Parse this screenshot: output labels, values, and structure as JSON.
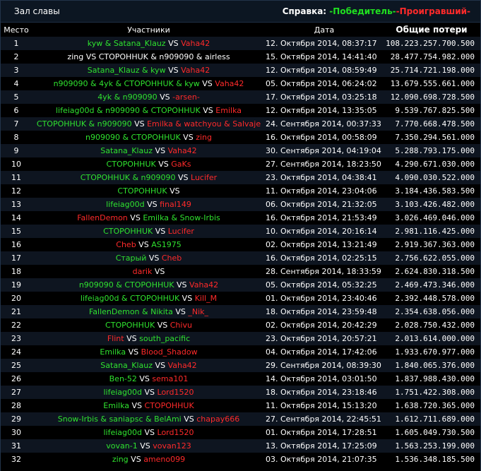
{
  "header": {
    "title": "Зал славы",
    "help_label": "Справка:",
    "legend_winner": "-Победитель-",
    "legend_loser": "-Проигравший-"
  },
  "columns": {
    "place": "Место",
    "participants": "Участники",
    "date": "Дата",
    "loss": "Общие потери"
  },
  "colors": {
    "winner": "#2fe22f",
    "loser": "#ff2a2a",
    "neutral": "#ffffff"
  },
  "rows": [
    {
      "n": "1",
      "w": "kyw & Satana_Klauz",
      "l": "Vaha42",
      "date": "12. Октября 2014, 08:37:17",
      "loss": "108.223.257.700.500"
    },
    {
      "n": "2",
      "w": "zing VS СТОРОННUK & n909090 & airless",
      "l": "",
      "neutral": true,
      "date": "15. Октября 2014, 14:41:40",
      "loss": "28.477.754.982.000"
    },
    {
      "n": "3",
      "w": "Satana_Klauz & kyw",
      "l": "Vaha42",
      "date": "12. Октября 2014, 08:59:49",
      "loss": "25.714.721.198.000"
    },
    {
      "n": "4",
      "w": "n909090 & 4yk & СТОРОННUK & kyw",
      "l": "Vaha42",
      "date": "05. Октября 2014, 06:24:02",
      "loss": "13.679.555.661.000"
    },
    {
      "n": "5",
      "w": "4yk & n909090",
      "l": "-arsen-",
      "date": "17. Октября 2014, 03:25:18",
      "loss": "12.090.698.728.500"
    },
    {
      "n": "6",
      "w": "lifeiag00d & n909090 & СТОРОННUK",
      "l": "Emilka",
      "date": "12. Октября 2014, 13:35:05",
      "loss": "9.539.767.825.500"
    },
    {
      "n": "7",
      "w": "СТОРОННUK & n909090",
      "l": "Emilka & watchyou & Salvaje",
      "date": "24. Сентября 2014, 00:37:33",
      "loss": "7.770.668.478.500"
    },
    {
      "n": "8",
      "w": "n909090 & СТОРОННUK",
      "l": "zing",
      "date": "16. Октября 2014, 00:58:09",
      "loss": "7.350.294.561.000"
    },
    {
      "n": "9",
      "w": "Satana_Klauz",
      "l": "Vaha42",
      "date": "30. Сентября 2014, 04:19:04",
      "loss": "5.288.793.175.000"
    },
    {
      "n": "10",
      "w": "СТОРОННUK",
      "l": "GaKs",
      "date": "27. Сентября 2014, 18:23:50",
      "loss": "4.290.671.030.000"
    },
    {
      "n": "11",
      "w": "СТОРОННUK & n909090",
      "l": "Lucifer",
      "date": "23. Октября 2014, 04:38:41",
      "loss": "4.090.030.522.000"
    },
    {
      "n": "12",
      "w": "СТОРОННUK",
      "l": "",
      "date": "11. Октября 2014, 23:04:06",
      "loss": "3.184.436.583.500"
    },
    {
      "n": "13",
      "w": "lifeiag00d",
      "l": "final149",
      "date": "06. Октября 2014, 21:32:05",
      "loss": "3.103.426.482.000"
    },
    {
      "n": "14",
      "w": "FallenDemon",
      "l": "Emilka & Snow-Irbis",
      "date": "16. Октября 2014, 21:53:49",
      "loss": "3.026.469.046.000",
      "swap": true
    },
    {
      "n": "15",
      "w": "СТОРОННUK",
      "l": "Lucifer",
      "date": "10. Октября 2014, 20:16:14",
      "loss": "2.981.116.425.000"
    },
    {
      "n": "16",
      "w": "Cheb",
      "l": "AS1975",
      "date": "02. Октября 2014, 13:21:49",
      "loss": "2.919.367.363.000",
      "swap": true
    },
    {
      "n": "17",
      "w": "Старый",
      "l": "Cheb",
      "date": "16. Октября 2014, 02:25:15",
      "loss": "2.756.622.055.000"
    },
    {
      "n": "18",
      "w": "darik",
      "l": "",
      "date": "28. Сентября 2014, 18:33:59",
      "loss": "2.624.830.318.500",
      "swap": true
    },
    {
      "n": "19",
      "w": "n909090 & СТОРОННUK",
      "l": "Vaha42",
      "date": "05. Октября 2014, 05:32:25",
      "loss": "2.469.473.346.000"
    },
    {
      "n": "20",
      "w": "lifeiag00d & СТОРОННUK",
      "l": "Kill_M",
      "date": "01. Октября 2014, 23:40:46",
      "loss": "2.392.448.578.000"
    },
    {
      "n": "21",
      "w": "FallenDemon & Nikita",
      "l": "_Nik_",
      "date": "18. Октября 2014, 23:59:48",
      "loss": "2.354.638.056.000"
    },
    {
      "n": "22",
      "w": "СТОРОННUK",
      "l": "Chivu",
      "date": "02. Октября 2014, 20:42:29",
      "loss": "2.028.750.432.000"
    },
    {
      "n": "23",
      "w": "Flint",
      "l": "south_pacific",
      "date": "23. Октября 2014, 20:57:21",
      "loss": "2.013.614.000.000",
      "swap": true
    },
    {
      "n": "24",
      "w": "Emilka",
      "l": "Blood_Shadow",
      "date": "04. Октября 2014, 17:42:06",
      "loss": "1.933.670.977.000"
    },
    {
      "n": "25",
      "w": "Satana_Klauz",
      "l": "Vaha42",
      "date": "29. Сентября 2014, 08:39:30",
      "loss": "1.840.065.376.000"
    },
    {
      "n": "26",
      "w": "Ben-52",
      "l": "sema101",
      "date": "14. Октября 2014, 03:01:50",
      "loss": "1.837.988.430.000"
    },
    {
      "n": "27",
      "w": "lifeiag00d",
      "l": "Lord1520",
      "date": "18. Октября 2014, 23:18:46",
      "loss": "1.751.422.308.000"
    },
    {
      "n": "28",
      "w": "Emilka",
      "l": "СТОРОННUK",
      "date": "11. Октября 2014, 15:13:20",
      "loss": "1.638.720.365.000"
    },
    {
      "n": "29",
      "w": "Snow-Irbis & saniapsc & BelAmi",
      "l": "chapay666",
      "date": "27. Сентября 2014, 22:45:51",
      "loss": "1.612.711.689.000"
    },
    {
      "n": "30",
      "w": "lifeiag00d",
      "l": "Lord1520",
      "date": "01. Октября 2014, 17:28:51",
      "loss": "1.605.049.730.500"
    },
    {
      "n": "31",
      "w": "vovan-1",
      "l": "vovan123",
      "date": "13. Октября 2014, 17:25:09",
      "loss": "1.563.253.199.000"
    },
    {
      "n": "32",
      "w": "zing",
      "l": "ameno099",
      "date": "03. Октября 2014, 21:07:35",
      "loss": "1.536.348.185.500"
    }
  ]
}
